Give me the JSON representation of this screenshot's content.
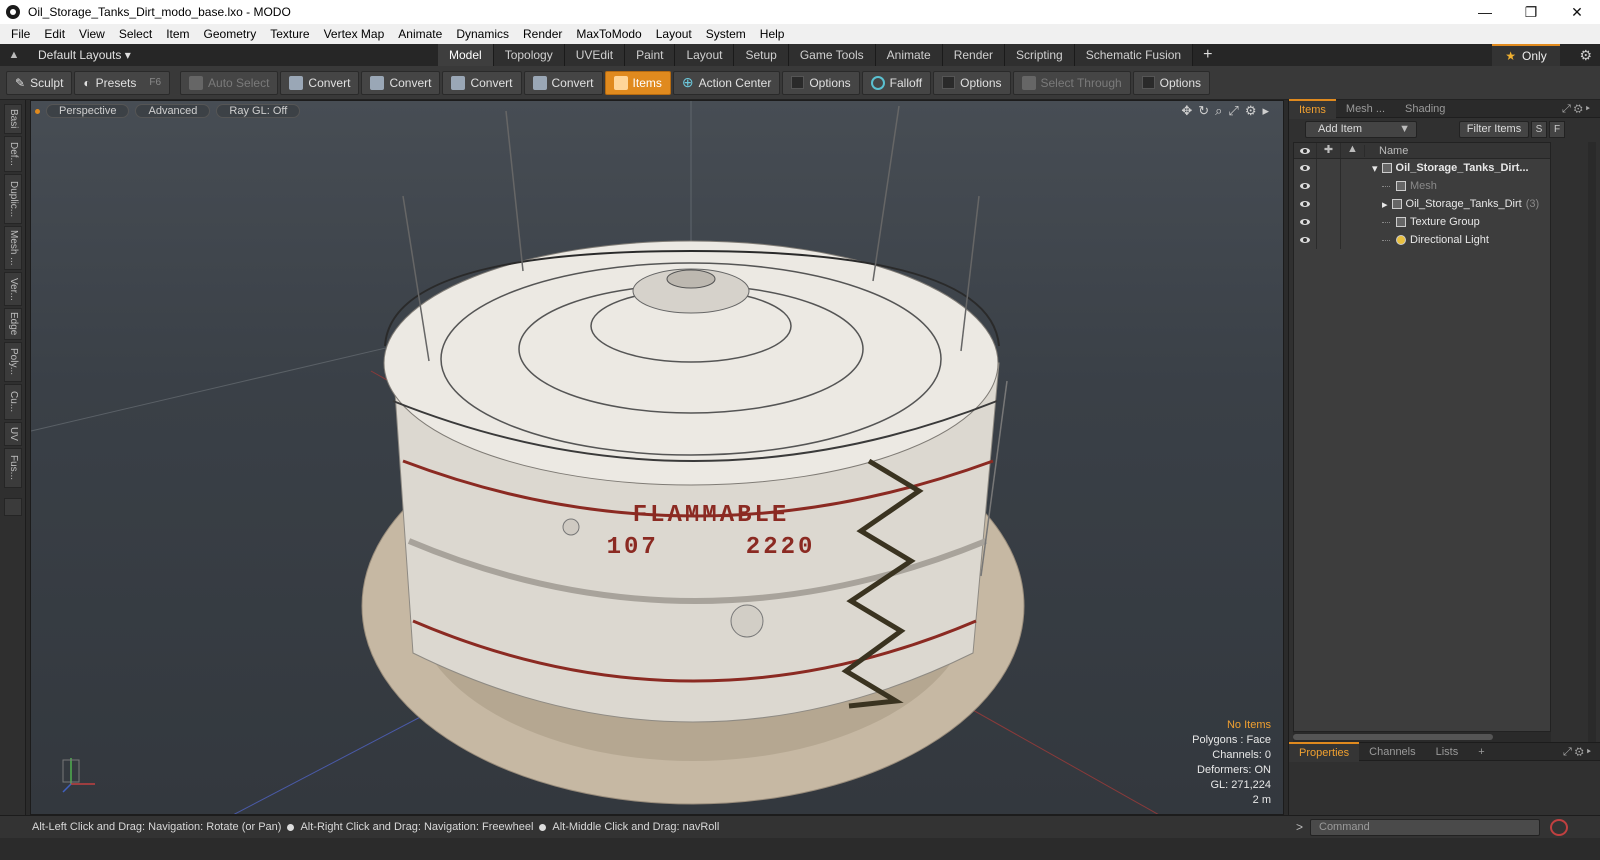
{
  "window": {
    "title": "Oil_Storage_Tanks_Dirt_modo_base.lxo - MODO",
    "minimize": "—",
    "maximize": "❐",
    "close": "✕"
  },
  "menu": [
    "File",
    "Edit",
    "View",
    "Select",
    "Item",
    "Geometry",
    "Texture",
    "Vertex Map",
    "Animate",
    "Dynamics",
    "Render",
    "MaxToModo",
    "Layout",
    "System",
    "Help"
  ],
  "layoutbar": {
    "layouts": "Default Layouts ▾",
    "tabs": [
      "Model",
      "Topology",
      "UVEdit",
      "Paint",
      "Layout",
      "Setup",
      "Game Tools",
      "Animate",
      "Render",
      "Scripting",
      "Schematic Fusion"
    ],
    "active_tab": "Model",
    "plus": "+",
    "only": "Only"
  },
  "toolbar": {
    "sculpt": "Sculpt",
    "presets": "Presets",
    "presets_key": "F6",
    "auto_select": "Auto Select",
    "convert1": "Convert",
    "convert2": "Convert",
    "convert3": "Convert",
    "convert4": "Convert",
    "items": "Items",
    "action_center": "Action Center",
    "options1": "Options",
    "falloff": "Falloff",
    "options2": "Options",
    "select_through": "Select Through",
    "options3": "Options"
  },
  "left_tabs": [
    "Basi",
    "Def...",
    "Duplic...",
    "Mesh ...",
    "Ver...",
    "Edge",
    "Poly...",
    "Cu...",
    "UV",
    "Fus..."
  ],
  "viewport": {
    "perspective": "Perspective",
    "advanced": "Advanced",
    "raygl": "Ray GL: Off",
    "label_line1": "FLAMMABLE",
    "label_line2": "107     2220",
    "hud": {
      "no_items": "No Items",
      "polygons": "Polygons : Face",
      "channels": "Channels: 0",
      "deformers": "Deformers: ON",
      "gl": "GL: 271,224",
      "scale": "2 m"
    },
    "colors": {
      "tank": "#e6e3dc",
      "stripe": "#8b2a22",
      "base": "#c9bba5",
      "accent": "#e08a1e"
    }
  },
  "items_panel": {
    "tabs": [
      "Items",
      "Mesh ...",
      "Shading"
    ],
    "active_tab": "Items",
    "add_item": "Add Item",
    "filter": "Filter Items",
    "s": "S",
    "f": "F",
    "name_header": "Name",
    "rows": [
      {
        "label": "Oil_Storage_Tanks_Dirt...",
        "style": "bold"
      },
      {
        "label": "Mesh",
        "style": "dim"
      },
      {
        "label": "Oil_Storage_Tanks_Dirt",
        "suffix": "(3)"
      },
      {
        "label": "Texture Group"
      },
      {
        "label": "Directional Light"
      }
    ]
  },
  "props_panel": {
    "tabs": [
      "Properties",
      "Channels",
      "Lists"
    ],
    "active_tab": "Properties",
    "plus": "+"
  },
  "status": {
    "hint1": "Alt-Left Click and Drag: Navigation: Rotate (or Pan)",
    "hint2": "Alt-Right Click and Drag: Navigation: Freewheel",
    "hint3": "Alt-Middle Click and Drag: navRoll"
  },
  "command": {
    "prompt": ">",
    "placeholder": "Command"
  }
}
